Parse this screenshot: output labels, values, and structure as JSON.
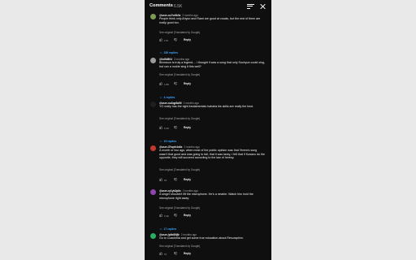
{
  "header": {
    "title": "Comments",
    "count": "6.5K"
  },
  "colors": {
    "panel_bg": "#0f0f0f",
    "link": "#3ea6ff",
    "secondary_text": "#aaaaaa"
  },
  "comments": [
    {
      "author": "@user-nc7vr6k9z",
      "time": "2 months ago",
      "text": "People think only Ahyun and Rami are good at vocals, but the rest of them are really good too.",
      "translate": "See original (Translated by Google)",
      "likes": "17K",
      "reply": "Reply",
      "replies": "230 replies",
      "avatar_color": "#7a9a55"
    },
    {
      "author": "@kd9d804",
      "time": "2 months ago",
      "text": "Binossun is truly a legend.... I thought it was a song that only Soohyun could sing, but can a rookie sing it this well?",
      "translate": "See original (Translated by Google)",
      "likes": "1.8K",
      "reply": "Reply",
      "replies": "4 replies",
      "avatar_color": "#9a9a9a"
    },
    {
      "author": "@user-nu3qp5a5ll",
      "time": "2 months ago",
      "text": "YG really has the right fundamentals hahaha his skills are really the best.",
      "translate": "See original (Translated by Google)",
      "likes": "6.2K",
      "reply": "Reply",
      "replies": "19 replies",
      "avatar_color": "#1f1f1f"
    },
    {
      "author": "@user-l7hqeh4o6x",
      "time": "2 months ago",
      "text": "A month or two ago, when most of the public opinion was that Yerem's song wasn't that good and was going to fail, that it was tacky, I felt that if Kowaro do the opposite, they will succeed according to the law of heresy.",
      "translate": "See original (Translated by Google)",
      "likes": "51",
      "reply": "Reply",
      "replies": "",
      "avatar_color": "#c0392b"
    },
    {
      "author": "@user-ry1yh2p6x",
      "time": "2 months ago",
      "text": "A singer shouldn't lift the microphone. He's a newbie. Watch him hold the microphone right away.",
      "translate": "See original (Translated by Google)",
      "likes": "5.3K",
      "reply": "Reply",
      "replies": "17 replies",
      "avatar_color": "#8e44ad"
    },
    {
      "author": "@user-lp6e89j8r",
      "time": "2 months ago",
      "text": "Go to Coachella and get some true education about Resuraphim.",
      "translate": "See original (Translated by Google)",
      "likes": "57",
      "reply": "Reply",
      "replies": "",
      "avatar_color": "#27ae60"
    }
  ]
}
